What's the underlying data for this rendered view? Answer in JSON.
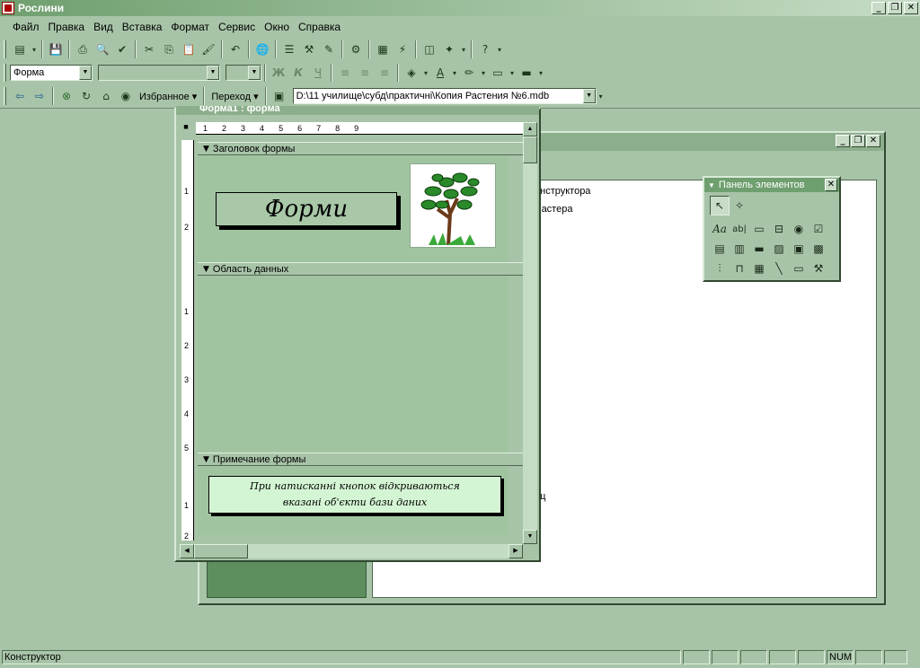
{
  "app": {
    "title": "Рослини"
  },
  "window_buttons": {
    "minimize": "_",
    "restore": "❐",
    "close": "✕"
  },
  "menu": [
    "Файл",
    "Правка",
    "Вид",
    "Вставка",
    "Формат",
    "Сервис",
    "Окно",
    "Справка"
  ],
  "format_toolbar": {
    "object_combo": "Форма",
    "font_combo": "",
    "size_combo": "",
    "bold": "Ж",
    "italic": "К",
    "underline": "Ч"
  },
  "web_toolbar": {
    "favorites": "Избранное ▾",
    "go": "Переход ▾",
    "address": "D:\\11 училище\\субд\\практичні\\Копия Растения №6.mdb"
  },
  "form_window": {
    "title": "Форма1 : форма",
    "ruler_marks": [
      "1",
      "2",
      "3",
      "4",
      "5",
      "6",
      "7",
      "8",
      "9"
    ],
    "vruler_marks": [
      "1",
      "2",
      "1",
      "2",
      "3",
      "4",
      "5",
      "1",
      "2"
    ],
    "header_section": "Заголовок формы",
    "header_label": "Форми",
    "detail_section": "Область данных",
    "footer_section": "Примечание формы",
    "footer_line1": "При натисканні кнопок відкриваються",
    "footer_line2": "вказані об'єкти бази даних"
  },
  "db_window": {
    "item1": "онструктора",
    "item2": "мастера",
    "item3": "иц"
  },
  "toolbox": {
    "title": "Панель элементов",
    "close": "✕"
  },
  "status": {
    "mode": "Конструктор",
    "num": "NUM"
  }
}
